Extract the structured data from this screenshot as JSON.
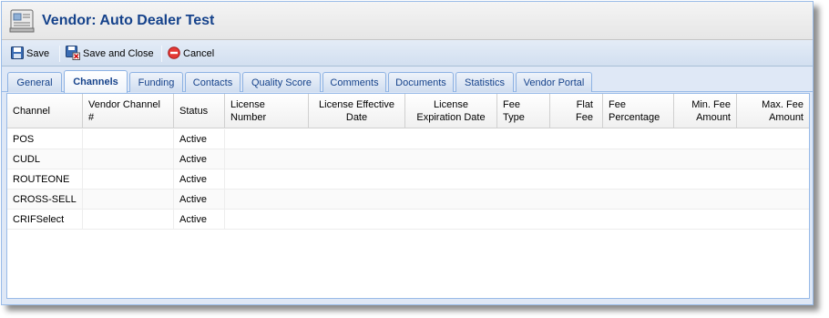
{
  "window": {
    "title": "Vendor: Auto Dealer Test",
    "icon": "vendor-form-icon"
  },
  "toolbar": {
    "save_label": "Save",
    "save_close_label": "Save and Close",
    "cancel_label": "Cancel"
  },
  "tabs": [
    {
      "label": "General",
      "active": false
    },
    {
      "label": "Channels",
      "active": true
    },
    {
      "label": "Funding",
      "active": false
    },
    {
      "label": "Contacts",
      "active": false
    },
    {
      "label": "Quality Score",
      "active": false
    },
    {
      "label": "Comments",
      "active": false
    },
    {
      "label": "Documents",
      "active": false
    },
    {
      "label": "Statistics",
      "active": false
    },
    {
      "label": "Vendor Portal",
      "active": false
    }
  ],
  "grid": {
    "columns": [
      {
        "label": "Channel"
      },
      {
        "label": "Vendor Channel #"
      },
      {
        "label": "Status"
      },
      {
        "label": "License Number"
      },
      {
        "label": "License Effective Date"
      },
      {
        "label": "License Expiration Date"
      },
      {
        "label": "Fee Type"
      },
      {
        "label": "Flat Fee"
      },
      {
        "label": "Fee Percentage"
      },
      {
        "label": "Min. Fee Amount"
      },
      {
        "label": "Max. Fee Amount"
      }
    ],
    "rows": [
      [
        "POS",
        "",
        "Active",
        "",
        "",
        "",
        "",
        "",
        "",
        "",
        ""
      ],
      [
        "CUDL",
        "",
        "Active",
        "",
        "",
        "",
        "",
        "",
        "",
        "",
        ""
      ],
      [
        "ROUTEONE",
        "",
        "Active",
        "",
        "",
        "",
        "",
        "",
        "",
        "",
        ""
      ],
      [
        "CROSS-SELL",
        "",
        "Active",
        "",
        "",
        "",
        "",
        "",
        "",
        "",
        ""
      ],
      [
        "CRIFSelect",
        "",
        "Active",
        "",
        "",
        "",
        "",
        "",
        "",
        "",
        ""
      ]
    ]
  },
  "colors": {
    "accent": "#15428b",
    "tab_border": "#8db2e3",
    "panel_bg": "#dfe8f6"
  }
}
